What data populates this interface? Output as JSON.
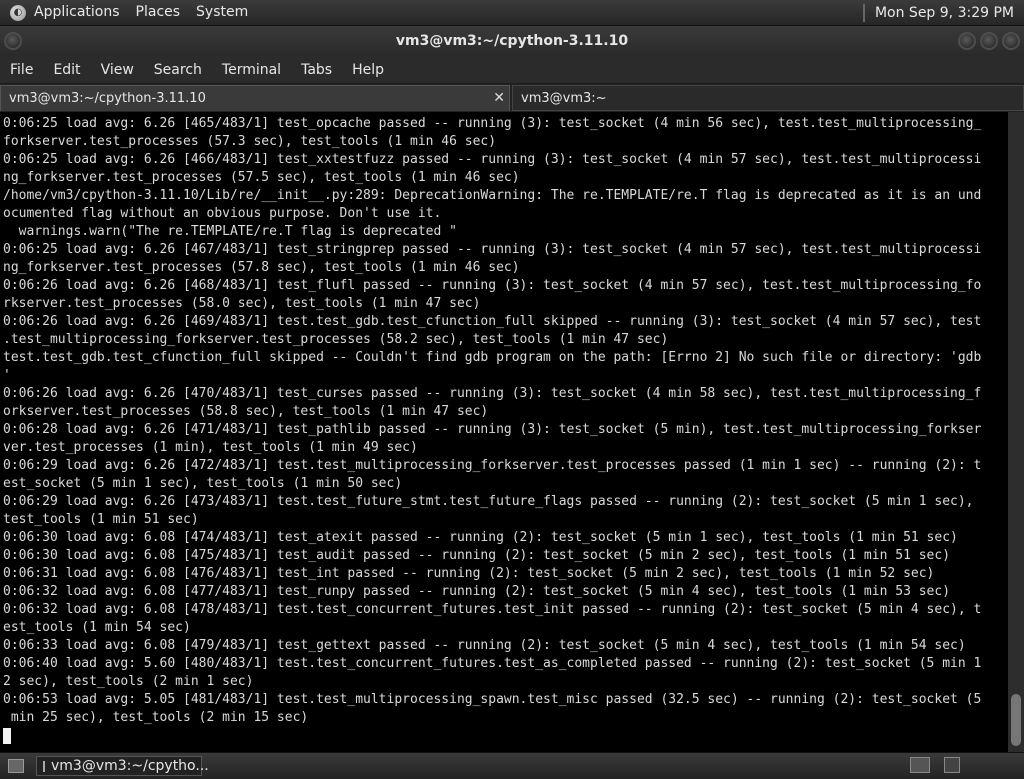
{
  "top_panel": {
    "menus": [
      "Applications",
      "Places",
      "System"
    ],
    "clock": "Mon Sep  9,  3:29 PM"
  },
  "window": {
    "title": "vm3@vm3:~/cpython-3.11.10"
  },
  "menubar": [
    "File",
    "Edit",
    "View",
    "Search",
    "Terminal",
    "Tabs",
    "Help"
  ],
  "tabs": [
    {
      "label": "vm3@vm3:~/cpython-3.11.10",
      "close": "✕"
    },
    {
      "label": "vm3@vm3:~",
      "close": ""
    }
  ],
  "terminal": {
    "lines": [
      "0:06:25 load avg: 6.26 [465/483/1] test_opcache passed -- running (3): test_socket (4 min 56 sec), test.test_multiprocessing_",
      "forkserver.test_processes (57.3 sec), test_tools (1 min 46 sec)",
      "0:06:25 load avg: 6.26 [466/483/1] test_xxtestfuzz passed -- running (3): test_socket (4 min 57 sec), test.test_multiprocessi",
      "ng_forkserver.test_processes (57.5 sec), test_tools (1 min 46 sec)",
      "/home/vm3/cpython-3.11.10/Lib/re/__init__.py:289: DeprecationWarning: The re.TEMPLATE/re.T flag is deprecated as it is an und",
      "ocumented flag without an obvious purpose. Don't use it.",
      "  warnings.warn(\"The re.TEMPLATE/re.T flag is deprecated \"",
      "0:06:25 load avg: 6.26 [467/483/1] test_stringprep passed -- running (3): test_socket (4 min 57 sec), test.test_multiprocessi",
      "ng_forkserver.test_processes (57.8 sec), test_tools (1 min 46 sec)",
      "0:06:26 load avg: 6.26 [468/483/1] test_flufl passed -- running (3): test_socket (4 min 57 sec), test.test_multiprocessing_fo",
      "rkserver.test_processes (58.0 sec), test_tools (1 min 47 sec)",
      "0:06:26 load avg: 6.26 [469/483/1] test.test_gdb.test_cfunction_full skipped -- running (3): test_socket (4 min 57 sec), test",
      ".test_multiprocessing_forkserver.test_processes (58.2 sec), test_tools (1 min 47 sec)",
      "test.test_gdb.test_cfunction_full skipped -- Couldn't find gdb program on the path: [Errno 2] No such file or directory: 'gdb",
      "'",
      "0:06:26 load avg: 6.26 [470/483/1] test_curses passed -- running (3): test_socket (4 min 58 sec), test.test_multiprocessing_f",
      "orkserver.test_processes (58.8 sec), test_tools (1 min 47 sec)",
      "0:06:28 load avg: 6.26 [471/483/1] test_pathlib passed -- running (3): test_socket (5 min), test.test_multiprocessing_forkser",
      "ver.test_processes (1 min), test_tools (1 min 49 sec)",
      "0:06:29 load avg: 6.26 [472/483/1] test.test_multiprocessing_forkserver.test_processes passed (1 min 1 sec) -- running (2): t",
      "est_socket (5 min 1 sec), test_tools (1 min 50 sec)",
      "0:06:29 load avg: 6.26 [473/483/1] test.test_future_stmt.test_future_flags passed -- running (2): test_socket (5 min 1 sec),",
      "test_tools (1 min 51 sec)",
      "0:06:30 load avg: 6.08 [474/483/1] test_atexit passed -- running (2): test_socket (5 min 1 sec), test_tools (1 min 51 sec)",
      "0:06:30 load avg: 6.08 [475/483/1] test_audit passed -- running (2): test_socket (5 min 2 sec), test_tools (1 min 51 sec)",
      "0:06:31 load avg: 6.08 [476/483/1] test_int passed -- running (2): test_socket (5 min 2 sec), test_tools (1 min 52 sec)",
      "0:06:32 load avg: 6.08 [477/483/1] test_runpy passed -- running (2): test_socket (5 min 4 sec), test_tools (1 min 53 sec)",
      "0:06:32 load avg: 6.08 [478/483/1] test.test_concurrent_futures.test_init passed -- running (2): test_socket (5 min 4 sec), t",
      "est_tools (1 min 54 sec)",
      "0:06:33 load avg: 6.08 [479/483/1] test_gettext passed -- running (2): test_socket (5 min 4 sec), test_tools (1 min 54 sec)",
      "0:06:40 load avg: 5.60 [480/483/1] test.test_concurrent_futures.test_as_completed passed -- running (2): test_socket (5 min 1",
      "2 sec), test_tools (2 min 1 sec)",
      "0:06:53 load avg: 5.05 [481/483/1] test.test_multiprocessing_spawn.test_misc passed (32.5 sec) -- running (2): test_socket (5",
      " min 25 sec), test_tools (2 min 15 sec)"
    ]
  },
  "bottom_panel": {
    "task_label": "vm3@vm3:~/cpytho..."
  }
}
